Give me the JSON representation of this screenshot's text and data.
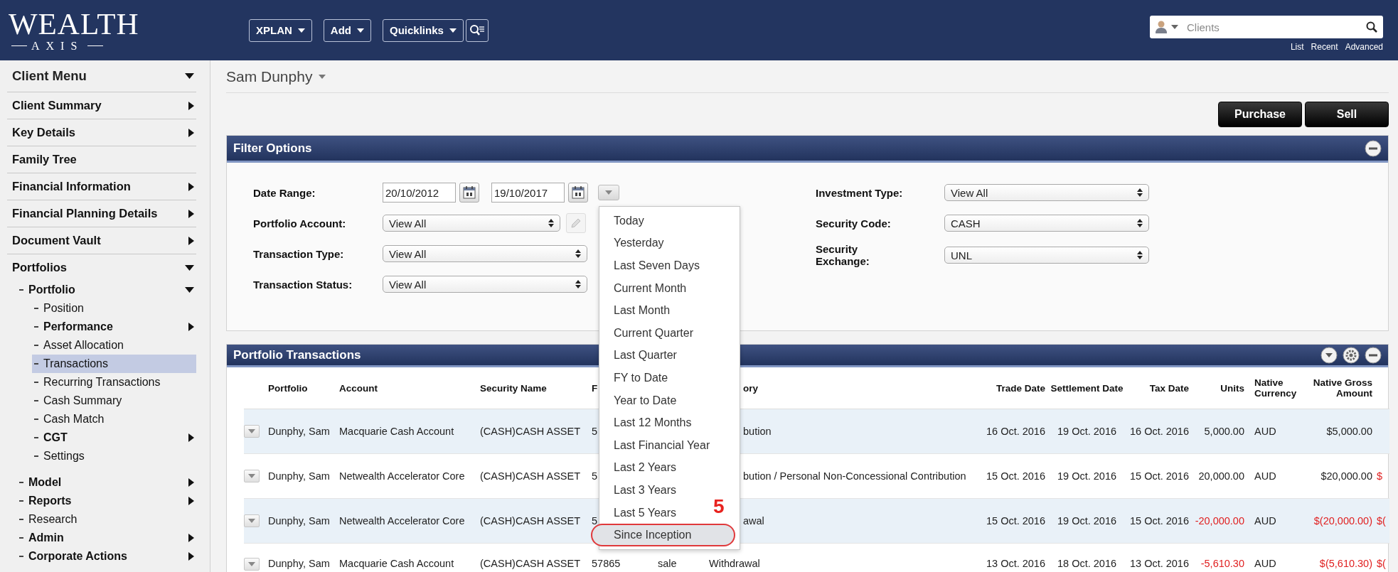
{
  "topbar": {
    "logo": {
      "word": "WEALTH",
      "subword": "AXIS"
    },
    "menus": [
      {
        "label": "XPLAN"
      },
      {
        "label": "Add"
      },
      {
        "label": "Quicklinks"
      }
    ],
    "search": {
      "placeholder": "Clients"
    },
    "links": [
      "List",
      "Recent",
      "Advanced"
    ]
  },
  "sidebar": {
    "title": {
      "label": "Client Menu",
      "expanded": true
    },
    "items": [
      {
        "label": "Client Summary",
        "expanded": false,
        "selected": false
      },
      {
        "label": "Key Details",
        "expanded": false,
        "selected": false
      },
      {
        "label": "Family Tree",
        "selected": false
      },
      {
        "label": "Financial Information",
        "expanded": false,
        "selected": false
      },
      {
        "label": "Financial Planning Details",
        "expanded": false,
        "selected": false
      },
      {
        "label": "Document Vault",
        "expanded": false,
        "selected": false
      },
      {
        "label": "Portfolios",
        "expanded": true,
        "selected": false,
        "children": [
          {
            "label": "Portfolio",
            "expanded": true,
            "selected": false,
            "children": [
              {
                "label": "Position",
                "selected": false
              },
              {
                "label": "Performance",
                "expanded": false,
                "selected": false
              },
              {
                "label": "Asset Allocation",
                "selected": false
              },
              {
                "label": "Transactions",
                "selected": true
              },
              {
                "label": "Recurring Transactions",
                "selected": false
              },
              {
                "label": "Cash Summary",
                "selected": false
              },
              {
                "label": "Cash Match",
                "selected": false
              },
              {
                "label": "CGT",
                "expanded": false,
                "selected": false
              },
              {
                "label": "Settings",
                "selected": false
              }
            ]
          },
          {
            "label": "Model",
            "expanded": false,
            "selected": false
          },
          {
            "label": "Reports",
            "expanded": false,
            "selected": false
          },
          {
            "label": "Research",
            "selected": false
          },
          {
            "label": "Admin",
            "expanded": false,
            "selected": false
          },
          {
            "label": "Corporate Actions",
            "expanded": false,
            "selected": false
          }
        ]
      }
    ]
  },
  "client": {
    "name": "Sam Dunphy"
  },
  "actions": [
    "Purchase",
    "Sell"
  ],
  "filter": {
    "title": "Filter Options",
    "left_fields": [
      {
        "kind": "date_range",
        "label": "Date Range:",
        "from": "20/10/2012",
        "to": "19/10/2017"
      },
      {
        "kind": "select_edit",
        "label": "Portfolio Account:",
        "value": "View All"
      },
      {
        "kind": "select",
        "label": "Transaction Type:",
        "value": "View All"
      },
      {
        "kind": "select",
        "label": "Transaction Status:",
        "value": "View All"
      }
    ],
    "right_fields": [
      {
        "kind": "select",
        "label": "Investment Type:",
        "value": "View All"
      },
      {
        "kind": "select",
        "label": "Security Code:",
        "value": "CASH"
      },
      {
        "kind": "select",
        "label": "Security Exchange:",
        "value": "UNL"
      }
    ]
  },
  "date_menu": {
    "items": [
      {
        "label": "Today",
        "selected": false
      },
      {
        "label": "Yesterday",
        "selected": false
      },
      {
        "label": "Last Seven Days",
        "selected": false
      },
      {
        "label": "Current Month",
        "selected": false
      },
      {
        "label": "Last Month",
        "selected": false
      },
      {
        "label": "Current Quarter",
        "selected": false
      },
      {
        "label": "Last Quarter",
        "selected": false
      },
      {
        "label": "FY to Date",
        "selected": false
      },
      {
        "label": "Year to Date",
        "selected": false
      },
      {
        "label": "Last 12 Months",
        "selected": false
      },
      {
        "label": "Last Financial Year",
        "selected": false
      },
      {
        "label": "Last 2 Years",
        "selected": false
      },
      {
        "label": "Last 3 Years",
        "selected": false
      },
      {
        "label": "Last 5 Years",
        "selected": false
      },
      {
        "label": "Since Inception",
        "selected": true
      }
    ],
    "annotation": "5"
  },
  "transactions": {
    "title": "Portfolio Transactions",
    "columns": [
      "Portfolio",
      "Account",
      "Security Name",
      "F",
      null,
      "ory",
      "Trade Date",
      "Settlement Date",
      "Tax Date",
      "Units",
      "Native Currency",
      "Native Gross Amount",
      null
    ],
    "rows": [
      {
        "negative": false,
        "cells": [
          "Dunphy, Sam",
          "Macquarie Cash Account",
          "(CASH)CASH ASSET",
          "5",
          null,
          "bution",
          "16 Oct. 2016",
          "19 Oct. 2016",
          "16 Oct. 2016",
          "5,000.00",
          "AUD",
          "$5,000.00",
          null
        ]
      },
      {
        "negative": false,
        "cells": [
          "Dunphy, Sam",
          "Netwealth Accelerator Core",
          "(CASH)CASH ASSET",
          "5",
          null,
          "bution / Personal Non-Concessional Contribution",
          "15 Oct. 2016",
          "19 Oct. 2016",
          "15 Oct. 2016",
          "20,000.00",
          "AUD",
          "$20,000.00",
          "$"
        ]
      },
      {
        "negative": true,
        "cells": [
          "Dunphy, Sam",
          "Netwealth Accelerator Core",
          "(CASH)CASH ASSET",
          "5",
          null,
          "awal",
          "15 Oct. 2016",
          "19 Oct. 2016",
          "15 Oct. 2016",
          "-20,000.00",
          "AUD",
          "$(20,000.00)",
          "$("
        ]
      },
      {
        "negative": true,
        "cells": [
          "Dunphy, Sam",
          "Macquarie Cash Account",
          "(CASH)CASH ASSET",
          "57865",
          "sale",
          "Withdrawal",
          "13 Oct. 2016",
          "18 Oct. 2016",
          "13 Oct. 2016",
          "-5,610.30",
          "AUD",
          "$(5,610.30)",
          "$("
        ]
      }
    ]
  }
}
